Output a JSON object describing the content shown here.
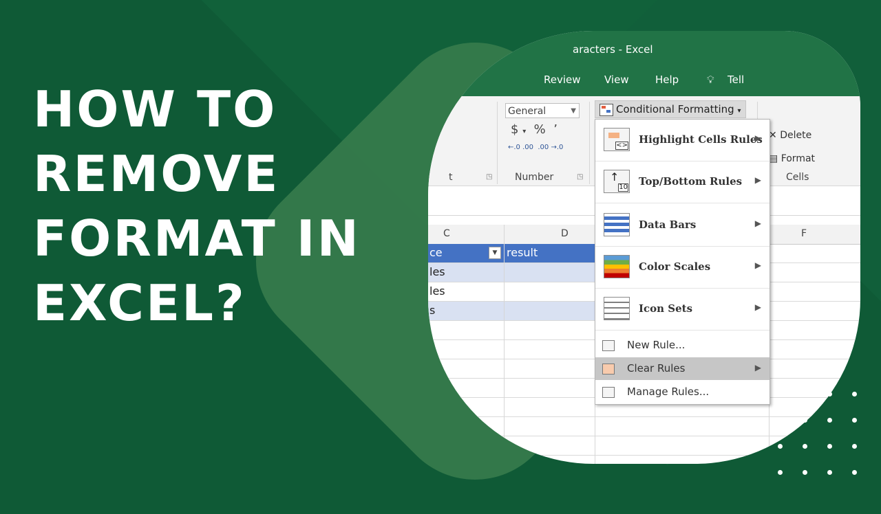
{
  "headline": {
    "line1": "HOW TO",
    "line2": "REMOVE",
    "line3": "FORMAT IN",
    "line4": "EXCEL?"
  },
  "excel": {
    "title_fragment": "aracters  -  Excel",
    "tabs": [
      "Review",
      "View",
      "Help",
      "Tell"
    ],
    "ribbon": {
      "number_format": "General",
      "currency_symbol": "$",
      "percent_symbol": "%",
      "comma_symbol": "’",
      "decimal_increase": "←.0 .00",
      "decimal_decrease": ".00 →.0",
      "group_label_left": "t",
      "group_label_number": "Number",
      "group_label_cells": "Cells",
      "conditional_formatting_label": "Conditional Formatting",
      "cells_items": [
        "Delete",
        "Format"
      ]
    },
    "columns": [
      "C",
      "D",
      "F"
    ],
    "rows": [
      {
        "c": "ce",
        "d": "result",
        "style": "header"
      },
      {
        "c": "les",
        "d": "",
        "style": "band"
      },
      {
        "c": "les",
        "d": "",
        "style": "plain"
      },
      {
        "c": "s",
        "d": "",
        "style": "band"
      }
    ],
    "menu": {
      "items": [
        {
          "label": "Highlight Cells Rules",
          "submenu": true
        },
        {
          "label": "Top/Bottom Rules",
          "submenu": true
        },
        {
          "label": "Data Bars",
          "submenu": true
        },
        {
          "label": "Color Scales",
          "submenu": true
        },
        {
          "label": "Icon Sets",
          "submenu": true
        },
        {
          "label": "New Rule...",
          "submenu": false
        },
        {
          "label": "Clear Rules",
          "submenu": true,
          "highlighted": true
        },
        {
          "label": "Manage Rules...",
          "submenu": false
        }
      ]
    }
  },
  "colors": {
    "background": "#0f5a36",
    "excel_green": "#217346",
    "table_header_blue": "#4472c4",
    "table_band": "#d9e1f2"
  }
}
